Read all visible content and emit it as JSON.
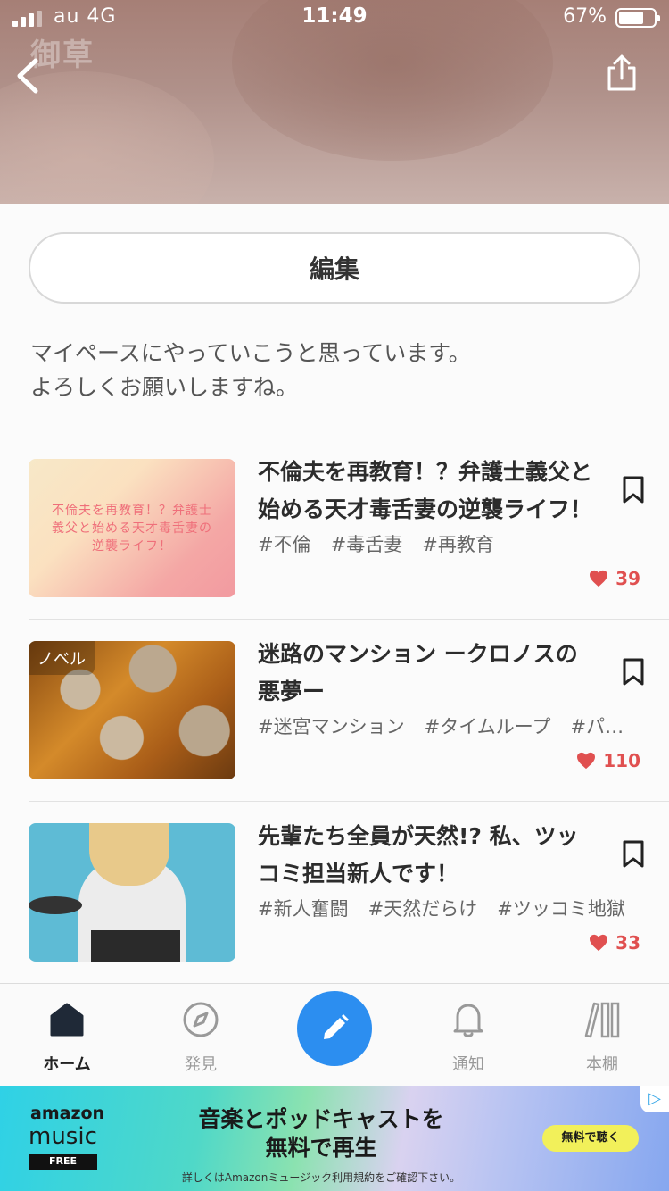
{
  "status_bar": {
    "carrier": "au  4G",
    "time": "11:49",
    "battery": "67%"
  },
  "header": {
    "watermark": "御草"
  },
  "profile": {
    "edit_label": "編集",
    "bio_line1": "マイペースにやっていこうと思っています。",
    "bio_line2": "よろしくお願いしますね。"
  },
  "works": [
    {
      "title": "不倫夫を再教育！？弁護士義父と始める天才毒舌妻の逆襲ライフ！",
      "thumb_text_line1": "不倫夫を再教育！？弁護士",
      "thumb_text_line2": "義父と始める天才毒舌妻の",
      "thumb_text_line3": "逆襲ライフ！",
      "tags": [
        "#不倫",
        "#毒舌妻",
        "#再教育"
      ],
      "likes": "39"
    },
    {
      "title": "迷路のマンション ークロノスの悪夢ー",
      "badge": "ノベル",
      "tags": [
        "#迷宮マンション",
        "#タイムループ",
        "#パ…"
      ],
      "likes": "110"
    },
    {
      "title": "先輩たち全員が天然!? 私、ツッコミ担当新人です！",
      "tags": [
        "#新人奮闘",
        "#天然だらけ",
        "#ツッコミ地獄"
      ],
      "likes": "33"
    }
  ],
  "tabbar": {
    "home": "ホーム",
    "discover": "発見",
    "notifications": "通知",
    "bookshelf": "本棚"
  },
  "ad": {
    "brand_line1": "amazon",
    "brand_line2": "music",
    "brand_badge": "FREE",
    "headline1": "音楽とポッドキャストを",
    "headline2": "無料で再生",
    "fine_print": "詳しくはAmazonミュージック利用規約をご確認下さい。",
    "cta": "無料で聴く"
  },
  "colors": {
    "accent": "#2c8ef0",
    "like": "#e05050"
  }
}
